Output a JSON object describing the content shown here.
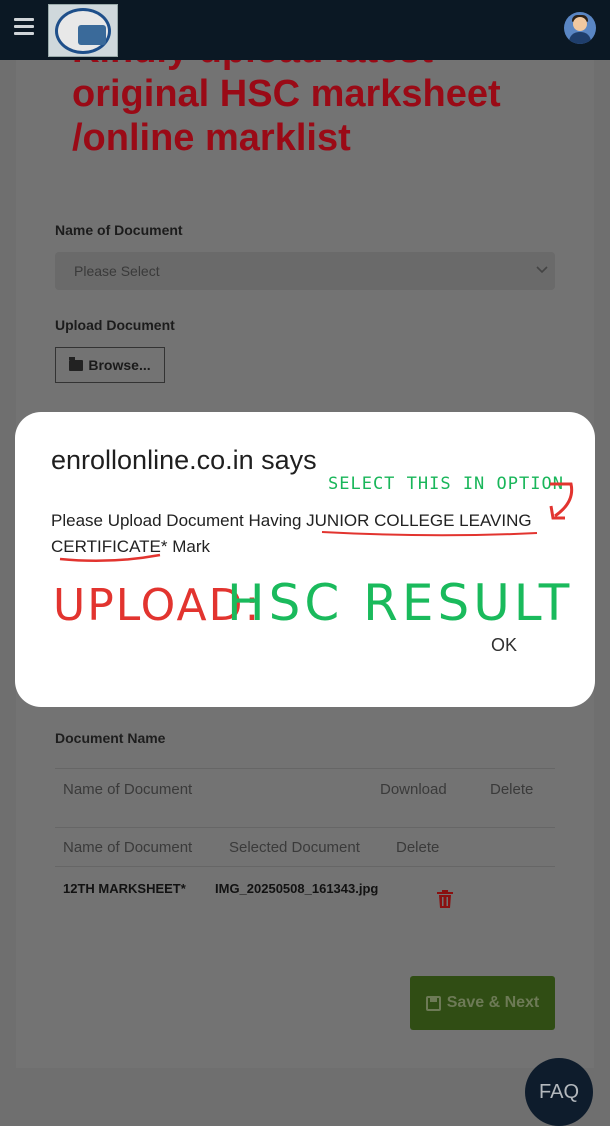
{
  "header": {
    "menu_icon": "hamburger-menu-icon",
    "logo_icon": "college-logo",
    "avatar_icon": "user-avatar-icon"
  },
  "page": {
    "title_line1": "Kindly upload latest",
    "title_line2": "original HSC marksheet",
    "title_line3": "/online marklist",
    "doc_name_label": "Name of Document",
    "select_placeholder": "Please Select",
    "upload_label": "Upload Document",
    "browse_button": "Browse...",
    "document_name_section": "Document Name",
    "table1_headers": [
      "Name of Document",
      "Download",
      "Delete"
    ],
    "table2_headers": [
      "Name of Document",
      "Selected Document",
      "Delete"
    ],
    "table2_rows": [
      {
        "name": "12TH MARKSHEET*",
        "file": "IMG_20250508_161343.jpg"
      }
    ],
    "save_button": "Save & Next",
    "faq_button": "FAQ"
  },
  "dialog": {
    "title": "enrollonline.co.in says",
    "message": "Please Upload Document Having JUNIOR COLLEGE LEAVING CERTIFICATE* Mark",
    "ok_button": "OK"
  },
  "annotations": {
    "select_hint": "SELECT THIS IN OPTION",
    "upload_label": "UPLOAD:",
    "upload_value": "HSC RESULT"
  },
  "colors": {
    "title_red": "#9a0a16",
    "save_green": "#304d14",
    "annotation_red": "#e2342f",
    "annotation_green": "#1aba5c"
  }
}
